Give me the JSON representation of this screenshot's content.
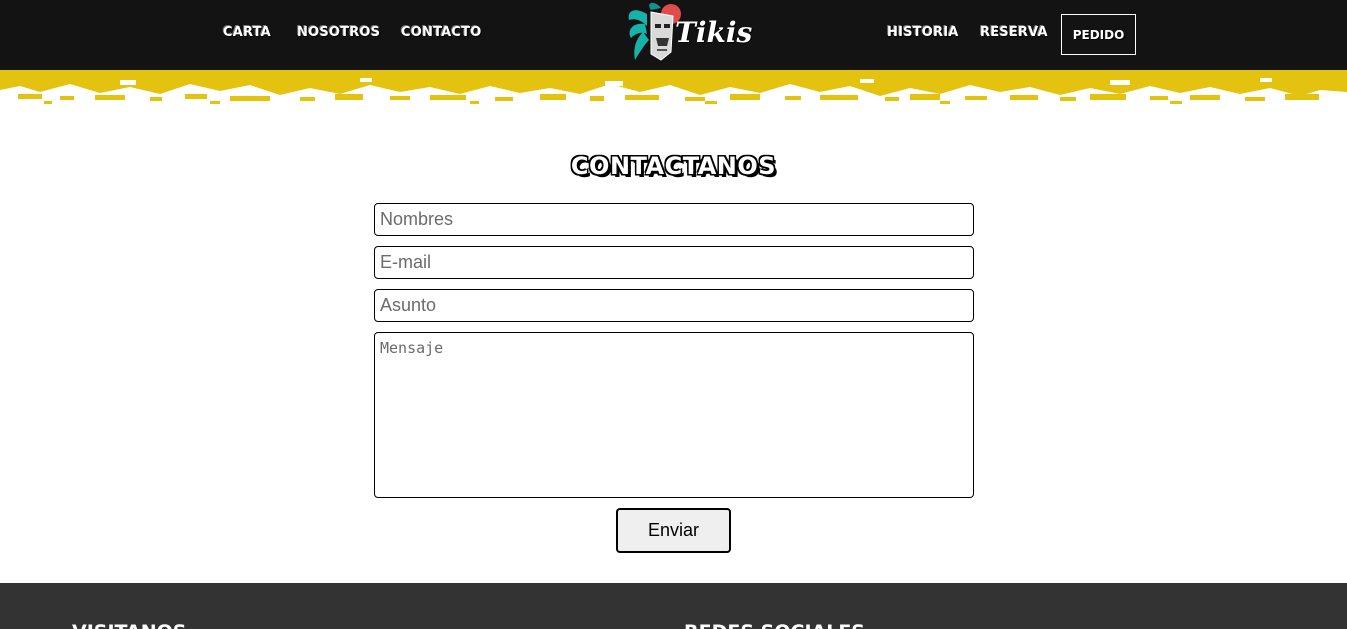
{
  "header": {
    "nav_left": [
      "CARTA",
      "NOSOTROS",
      "CONTACTO"
    ],
    "nav_right": [
      "HISTORIA",
      "RESERVA"
    ],
    "cta_label": "PEDIDO",
    "logo_text": "Tikis",
    "colors": {
      "background": "#131313",
      "accent_yellow": "#e3c30f",
      "logo_teal": "#17b3a8",
      "logo_red": "#e04b4b"
    }
  },
  "contact": {
    "title": "CONTACTANOS",
    "fields": {
      "name_placeholder": "Nombres",
      "email_placeholder": "E-mail",
      "subject_placeholder": "Asunto",
      "message_placeholder": "Mensaje"
    },
    "submit_label": "Enviar"
  },
  "footer": {
    "headings": [
      "VISITANOS",
      "REDES SOCIALES"
    ],
    "colors": {
      "background": "#333333"
    }
  }
}
